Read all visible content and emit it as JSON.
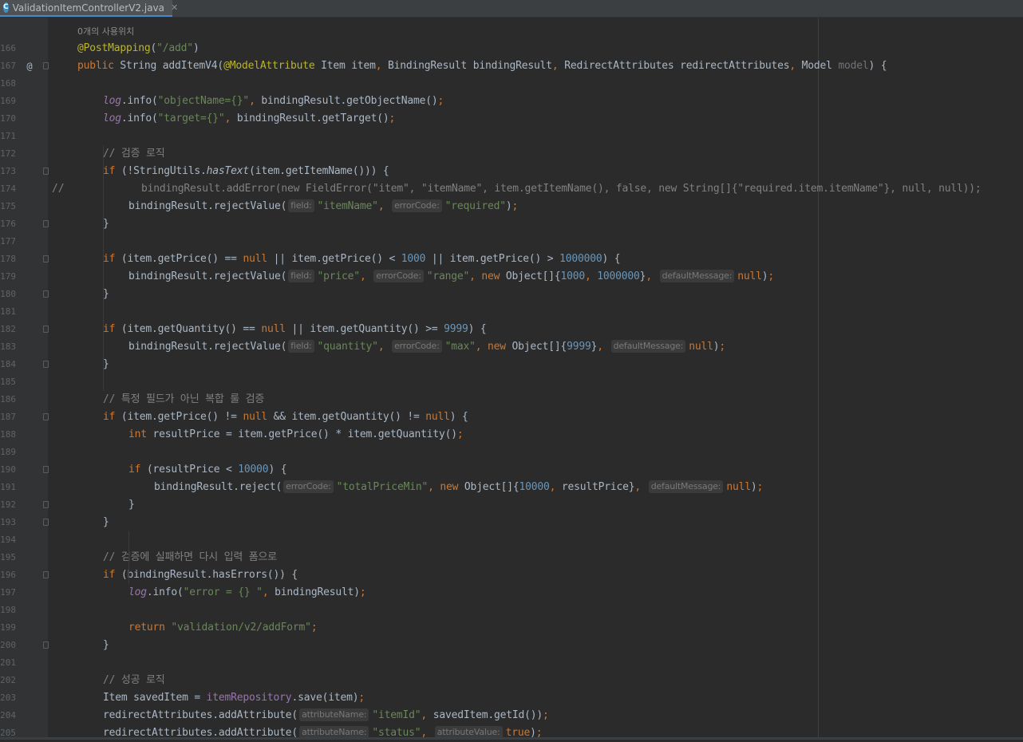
{
  "tab": {
    "filename": "ValidationItemControllerV2.java",
    "icon": "java-class-icon"
  },
  "usages_hint": "0개의 사용위치",
  "lines": [
    {
      "n": "166",
      "mark": "",
      "fold": false,
      "ind": 0,
      "t": [
        [
          "ann",
          "@PostMapping"
        ],
        [
          "",
          "("
        ],
        [
          "str",
          "\"/add\""
        ],
        [
          "",
          ")"
        ]
      ]
    },
    {
      "n": "167",
      "mark": "@",
      "fold": true,
      "ind": 0,
      "t": [
        [
          "kw",
          "public "
        ],
        [
          "",
          "String "
        ],
        [
          "",
          "addItemV4"
        ],
        [
          "",
          "("
        ],
        [
          "ann",
          "@ModelAttribute "
        ],
        [
          "",
          "Item item"
        ],
        [
          "kw",
          ", "
        ],
        [
          "",
          "BindingResult bindingResult"
        ],
        [
          "kw",
          ", "
        ],
        [
          "",
          "RedirectAttributes redirectAttributes"
        ],
        [
          "kw",
          ", "
        ],
        [
          "",
          "Model "
        ],
        [
          "gray",
          "model"
        ],
        [
          "",
          ") {"
        ]
      ]
    },
    {
      "n": "168",
      "mark": "",
      "fold": false,
      "ind": 0,
      "t": []
    },
    {
      "n": "169",
      "mark": "",
      "fold": false,
      "ind": 1,
      "t": [
        [
          "fld",
          "log"
        ],
        [
          "",
          ".info("
        ],
        [
          "str",
          "\"objectName={}\""
        ],
        [
          "kw",
          ", "
        ],
        [
          "",
          "bindingResult.getObjectName()"
        ],
        [
          "kw",
          ";"
        ]
      ]
    },
    {
      "n": "170",
      "mark": "",
      "fold": false,
      "ind": 1,
      "t": [
        [
          "fld",
          "log"
        ],
        [
          "",
          ".info("
        ],
        [
          "str",
          "\"target={}\""
        ],
        [
          "kw",
          ", "
        ],
        [
          "",
          "bindingResult.getTarget()"
        ],
        [
          "kw",
          ";"
        ]
      ]
    },
    {
      "n": "171",
      "mark": "",
      "fold": false,
      "ind": 0,
      "t": []
    },
    {
      "n": "172",
      "mark": "",
      "fold": false,
      "ind": 1,
      "t": [
        [
          "cm",
          "// 검증 로직"
        ]
      ]
    },
    {
      "n": "173",
      "mark": "",
      "fold": true,
      "ind": 1,
      "t": [
        [
          "kw",
          "if "
        ],
        [
          "",
          "(!StringUtils."
        ],
        [
          "st",
          "hasText"
        ],
        [
          "",
          "(item.getItemName())) {"
        ]
      ]
    },
    {
      "n": "174",
      "mark": "//",
      "fold": false,
      "ind": 2.5,
      "t": [
        [
          "cm",
          "bindingResult.addError(new FieldError(\"item\", \"itemName\", item.getItemName(), false, new String[]{\"required.item.itemName\"}, null, null));"
        ]
      ]
    },
    {
      "n": "175",
      "mark": "",
      "fold": false,
      "ind": 2,
      "t": [
        [
          "",
          "bindingResult.rejectValue("
        ],
        [
          "hint",
          "field:"
        ],
        [
          "str",
          "\"itemName\""
        ],
        [
          "kw",
          ", "
        ],
        [
          "hint",
          "errorCode:"
        ],
        [
          "str",
          "\"required\""
        ],
        [
          "",
          ")"
        ],
        [
          "kw",
          ";"
        ]
      ]
    },
    {
      "n": "176",
      "mark": "",
      "fold": true,
      "ind": 1,
      "t": [
        [
          "",
          "}"
        ]
      ]
    },
    {
      "n": "177",
      "mark": "",
      "fold": false,
      "ind": 0,
      "t": []
    },
    {
      "n": "178",
      "mark": "",
      "fold": true,
      "ind": 1,
      "t": [
        [
          "kw",
          "if "
        ],
        [
          "",
          "(item.getPrice() == "
        ],
        [
          "kw",
          "null "
        ],
        [
          "",
          "|| item.getPrice() < "
        ],
        [
          "num",
          "1000 "
        ],
        [
          "",
          "|| item.getPrice() > "
        ],
        [
          "num",
          "1000000"
        ],
        [
          "",
          ") {"
        ]
      ]
    },
    {
      "n": "179",
      "mark": "",
      "fold": false,
      "ind": 2,
      "t": [
        [
          "",
          "bindingResult.rejectValue("
        ],
        [
          "hint",
          "field:"
        ],
        [
          "str",
          "\"price\""
        ],
        [
          "kw",
          ", "
        ],
        [
          "hint",
          "errorCode:"
        ],
        [
          "str",
          "\"range\""
        ],
        [
          "kw",
          ", new "
        ],
        [
          "",
          "Object[]{"
        ],
        [
          "num",
          "1000"
        ],
        [
          "kw",
          ", "
        ],
        [
          "num",
          "1000000"
        ],
        [
          "",
          "}"
        ],
        [
          "kw",
          ", "
        ],
        [
          "hint",
          "defaultMessage:"
        ],
        [
          "kw",
          "null"
        ],
        [
          "",
          ")"
        ],
        [
          "kw",
          ";"
        ]
      ]
    },
    {
      "n": "180",
      "mark": "",
      "fold": true,
      "ind": 1,
      "t": [
        [
          "",
          "}"
        ]
      ]
    },
    {
      "n": "181",
      "mark": "",
      "fold": false,
      "ind": 0,
      "t": []
    },
    {
      "n": "182",
      "mark": "",
      "fold": true,
      "ind": 1,
      "t": [
        [
          "kw",
          "if "
        ],
        [
          "",
          "(item.getQuantity() == "
        ],
        [
          "kw",
          "null "
        ],
        [
          "",
          "|| item.getQuantity() >= "
        ],
        [
          "num",
          "9999"
        ],
        [
          "",
          ") {"
        ]
      ]
    },
    {
      "n": "183",
      "mark": "",
      "fold": false,
      "ind": 2,
      "t": [
        [
          "",
          "bindingResult.rejectValue("
        ],
        [
          "hint",
          "field:"
        ],
        [
          "str",
          "\"quantity\""
        ],
        [
          "kw",
          ", "
        ],
        [
          "hint",
          "errorCode:"
        ],
        [
          "str",
          "\"max\""
        ],
        [
          "kw",
          ", new "
        ],
        [
          "",
          "Object[]{"
        ],
        [
          "num",
          "9999"
        ],
        [
          "",
          "}"
        ],
        [
          "kw",
          ", "
        ],
        [
          "hint",
          "defaultMessage:"
        ],
        [
          "kw",
          "null"
        ],
        [
          "",
          ")"
        ],
        [
          "kw",
          ";"
        ]
      ]
    },
    {
      "n": "184",
      "mark": "",
      "fold": true,
      "ind": 1,
      "t": [
        [
          "",
          "}"
        ]
      ]
    },
    {
      "n": "185",
      "mark": "",
      "fold": false,
      "ind": 0,
      "t": []
    },
    {
      "n": "186",
      "mark": "",
      "fold": false,
      "ind": 1,
      "t": [
        [
          "cm",
          "// 특정 필드가 아닌 복합 룰 검증"
        ]
      ]
    },
    {
      "n": "187",
      "mark": "",
      "fold": true,
      "ind": 1,
      "t": [
        [
          "kw",
          "if "
        ],
        [
          "",
          "(item.getPrice() != "
        ],
        [
          "kw",
          "null "
        ],
        [
          "",
          "&& item.getQuantity() != "
        ],
        [
          "kw",
          "null"
        ],
        [
          "",
          ") {"
        ]
      ]
    },
    {
      "n": "188",
      "mark": "",
      "fold": false,
      "ind": 2,
      "t": [
        [
          "kw",
          "int "
        ],
        [
          "",
          "resultPrice = item.getPrice() * item.getQuantity()"
        ],
        [
          "kw",
          ";"
        ]
      ]
    },
    {
      "n": "189",
      "mark": "",
      "fold": false,
      "ind": 0,
      "t": []
    },
    {
      "n": "190",
      "mark": "",
      "fold": true,
      "ind": 2,
      "t": [
        [
          "kw",
          "if "
        ],
        [
          "",
          "(resultPrice < "
        ],
        [
          "num",
          "10000"
        ],
        [
          "",
          ") {"
        ]
      ]
    },
    {
      "n": "191",
      "mark": "",
      "fold": false,
      "ind": 3,
      "t": [
        [
          "",
          "bindingResult.reject("
        ],
        [
          "hint",
          "errorCode:"
        ],
        [
          "str",
          "\"totalPriceMin\""
        ],
        [
          "kw",
          ", new "
        ],
        [
          "",
          "Object[]{"
        ],
        [
          "num",
          "10000"
        ],
        [
          "kw",
          ", "
        ],
        [
          "",
          "resultPrice}"
        ],
        [
          "kw",
          ", "
        ],
        [
          "hint",
          "defaultMessage:"
        ],
        [
          "kw",
          "null"
        ],
        [
          "",
          ")"
        ],
        [
          "kw",
          ";"
        ]
      ]
    },
    {
      "n": "192",
      "mark": "",
      "fold": true,
      "ind": 2,
      "t": [
        [
          "",
          "}"
        ]
      ]
    },
    {
      "n": "193",
      "mark": "",
      "fold": true,
      "ind": 1,
      "t": [
        [
          "",
          "}"
        ]
      ]
    },
    {
      "n": "194",
      "mark": "",
      "fold": false,
      "ind": 0,
      "t": []
    },
    {
      "n": "195",
      "mark": "",
      "fold": false,
      "ind": 1,
      "t": [
        [
          "cm",
          "// 검증에 실패하면 다시 입력 폼으로"
        ]
      ]
    },
    {
      "n": "196",
      "mark": "",
      "fold": true,
      "ind": 1,
      "t": [
        [
          "kw",
          "if "
        ],
        [
          "",
          "(bindingResult.hasErrors()) {"
        ]
      ]
    },
    {
      "n": "197",
      "mark": "",
      "fold": false,
      "ind": 2,
      "t": [
        [
          "fld",
          "log"
        ],
        [
          "",
          ".info("
        ],
        [
          "str",
          "\"error = {} \""
        ],
        [
          "kw",
          ", "
        ],
        [
          "",
          "bindingResult)"
        ],
        [
          "kw",
          ";"
        ]
      ]
    },
    {
      "n": "198",
      "mark": "",
      "fold": false,
      "ind": 0,
      "t": []
    },
    {
      "n": "199",
      "mark": "",
      "fold": false,
      "ind": 2,
      "t": [
        [
          "kw",
          "return "
        ],
        [
          "str",
          "\"validation/v2/addForm\""
        ],
        [
          "kw",
          ";"
        ]
      ]
    },
    {
      "n": "200",
      "mark": "",
      "fold": true,
      "ind": 1,
      "t": [
        [
          "",
          "}"
        ]
      ]
    },
    {
      "n": "201",
      "mark": "",
      "fold": false,
      "ind": 0,
      "t": []
    },
    {
      "n": "202",
      "mark": "",
      "fold": false,
      "ind": 1,
      "t": [
        [
          "cm",
          "// 성공 로직"
        ]
      ]
    },
    {
      "n": "203",
      "mark": "",
      "fold": false,
      "ind": 1,
      "t": [
        [
          "",
          "Item savedItem = "
        ],
        [
          "fldn",
          "itemRepository"
        ],
        [
          "",
          ".save(item)"
        ],
        [
          "kw",
          ";"
        ]
      ]
    },
    {
      "n": "204",
      "mark": "",
      "fold": false,
      "ind": 1,
      "t": [
        [
          "",
          "redirectAttributes.addAttribute("
        ],
        [
          "hint",
          "attributeName:"
        ],
        [
          "str",
          "\"itemId\""
        ],
        [
          "kw",
          ", "
        ],
        [
          "",
          "savedItem.getId())"
        ],
        [
          "kw",
          ";"
        ]
      ]
    },
    {
      "n": "205",
      "mark": "",
      "fold": false,
      "ind": 1,
      "t": [
        [
          "",
          "redirectAttributes.addAttribute("
        ],
        [
          "hint",
          "attributeName:"
        ],
        [
          "str",
          "\"status\""
        ],
        [
          "kw",
          ", "
        ],
        [
          "hint",
          "attributeValue:"
        ],
        [
          "kw",
          "true"
        ],
        [
          "",
          ")"
        ],
        [
          "kw",
          ";"
        ]
      ]
    }
  ]
}
